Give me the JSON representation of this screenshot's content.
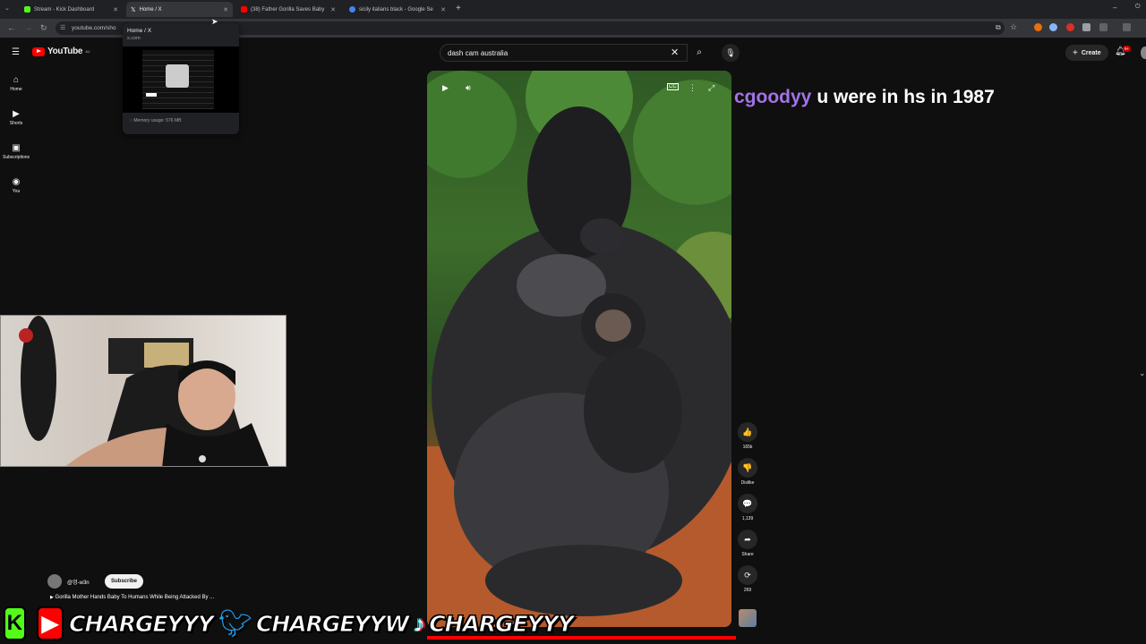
{
  "tabs": [
    {
      "label": "Stream - Kick Dashboard",
      "icon": "kick-icon",
      "color": "#53fc18"
    },
    {
      "label": "Home / X",
      "icon": "x-logo-icon",
      "color": "#ffffff"
    },
    {
      "label": "(38) Father Gorilla Saves Baby",
      "icon": "youtube-icon",
      "color": "#ff0000"
    },
    {
      "label": "sicily italians black - Google Se",
      "icon": "google-icon",
      "color": "#4285f4"
    }
  ],
  "address": "youtube.com/sho",
  "hovercard": {
    "title": "Home / X",
    "url": "x.com",
    "memory": "Memory usage: 576 MB"
  },
  "youtube": {
    "logo": "YouTube",
    "region": "AU",
    "sidebar": [
      {
        "label": "Home",
        "icon": "home-icon",
        "glyph": "⌂"
      },
      {
        "label": "Shorts",
        "icon": "shorts-icon",
        "glyph": "▶"
      },
      {
        "label": "Subscriptions",
        "icon": "subscriptions-icon",
        "glyph": "▣"
      },
      {
        "label": "You",
        "icon": "account-icon",
        "glyph": "◉"
      }
    ],
    "search_value": "dash cam australia",
    "create_label": "Create",
    "notification_badge": "9+"
  },
  "actions": [
    {
      "name": "like",
      "glyph": "👍",
      "label": "165k"
    },
    {
      "name": "dislike",
      "glyph": "👎",
      "label": "Dislike"
    },
    {
      "name": "comments",
      "glyph": "💬",
      "label": "1,139"
    },
    {
      "name": "share",
      "glyph": "➦",
      "label": "Share"
    },
    {
      "name": "remix",
      "glyph": "⟳",
      "label": "269"
    }
  ],
  "chat": {
    "user": "cgoodyy",
    "message": "u were in hs in 1987"
  },
  "channel": {
    "name": "@엉-w3n",
    "subscribe": "Subscribe",
    "video_title": "Gorilla Mother Hands Baby To Humans While Being Attacked By ..."
  },
  "banner": {
    "handle_youtube": "CHARGEYYY",
    "handle_twitter": "CHARGEYYW",
    "handle_tiktok": "CHARGEYYY"
  }
}
